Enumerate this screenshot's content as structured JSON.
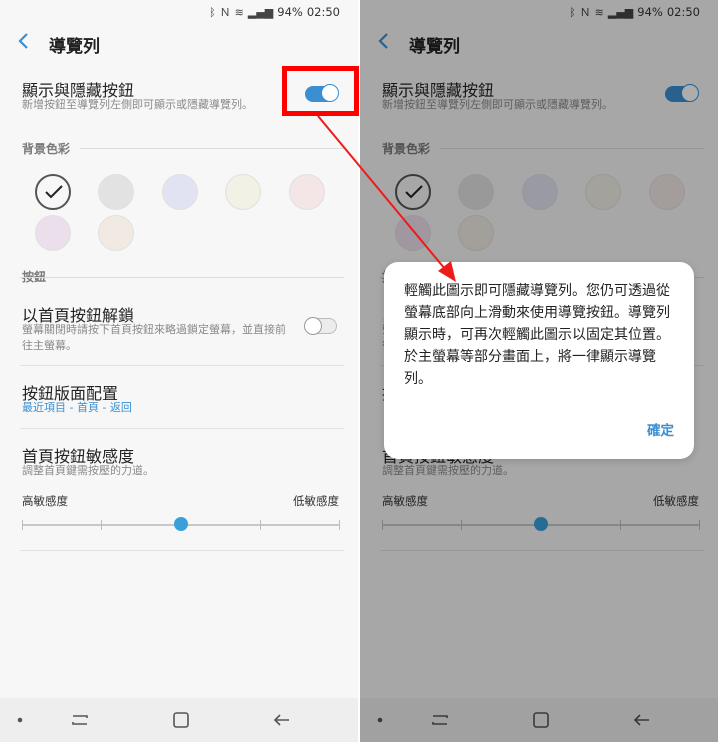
{
  "status": {
    "battery": "94%",
    "time": "02:50"
  },
  "app": {
    "title": "導覽列"
  },
  "settings": {
    "show_hide": {
      "title": "顯示與隱藏按鈕",
      "subtitle": "新增按鈕至導覽列左側即可顯示或隱藏導覽列。",
      "enabled": true
    },
    "background_section": "背景色彩",
    "colors": [
      "#f7f7f7",
      "#e2e2e2",
      "#e2e3f2",
      "#f1f1e6",
      "#f4e6e6",
      "#ecdfec",
      "#f1eae3"
    ],
    "selected_color_index": 0,
    "buttons_section": "按鈕",
    "unlock_home": {
      "title": "以首頁按鈕解鎖",
      "subtitle": "螢幕關閉時請按下首頁按鈕來略過鎖定螢幕，並直接前往主螢幕。",
      "enabled": false
    },
    "layout": {
      "title": "按鈕版面配置",
      "value": "最近項目 - 首頁 - 返回"
    },
    "sensitivity": {
      "title": "首頁按鈕敏感度",
      "subtitle": "調整首頁鍵需按壓的力道。",
      "high_label": "高敏感度",
      "low_label": "低敏感度",
      "level": 0.5
    }
  },
  "dialog": {
    "message": "輕觸此圖示即可隱藏導覽列。您仍可透過從螢幕底部向上滑動來使用導覽按鈕。導覽列顯示時，可再次輕觸此圖示以固定其位置。於主螢幕等部分畫面上，將一律顯示導覽列。",
    "ok_label": "確定"
  },
  "annotation": {
    "highlight_color": "#ff0000",
    "arrow_color": "#ee1b1b"
  },
  "icons": {
    "status": [
      "bluetooth-icon",
      "nfc-icon",
      "wifi-icon",
      "signal-icon"
    ],
    "nav": [
      "dot-icon",
      "recents-icon",
      "home-icon",
      "back-arrow-icon"
    ]
  }
}
